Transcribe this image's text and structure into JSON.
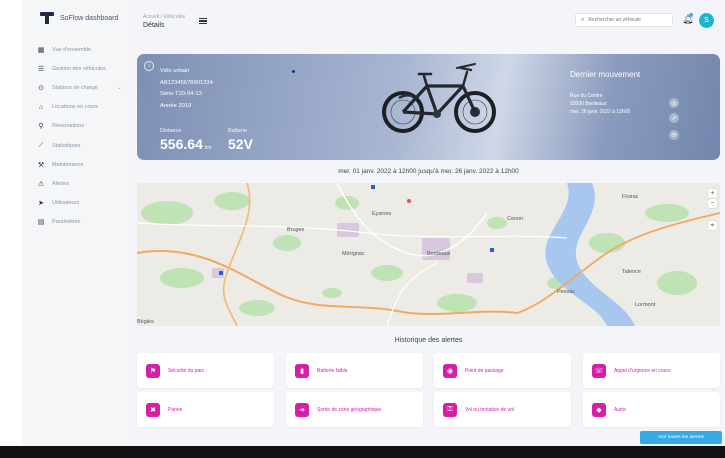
{
  "brand": {
    "name": "SoFlow dashboard"
  },
  "sidebar": {
    "items": [
      {
        "label": "Vue d'ensemble",
        "icon": "grid-icon",
        "glyph": "▦"
      },
      {
        "label": "Gestion des véhicules",
        "icon": "list-icon",
        "glyph": "☰"
      },
      {
        "label": "Stations de charge",
        "icon": "pin-icon",
        "glyph": "⊙",
        "has_caret": true
      },
      {
        "label": "Locations en cours",
        "icon": "scooter-icon",
        "glyph": "⌂"
      },
      {
        "label": "Réservations",
        "icon": "calendar-icon",
        "glyph": "⚲"
      },
      {
        "label": "Statistiques",
        "icon": "chart-icon",
        "glyph": "⟋"
      },
      {
        "label": "Maintenance",
        "icon": "wrench-icon",
        "glyph": "⚒"
      },
      {
        "label": "Alertes",
        "icon": "bell-icon",
        "glyph": "⚠"
      },
      {
        "label": "Utilisateurs",
        "icon": "user-icon",
        "glyph": "➤"
      },
      {
        "label": "Paramètres",
        "icon": "settings-icon",
        "glyph": "▤"
      }
    ]
  },
  "header": {
    "breadcrumb": "Accueil / Véhicules",
    "title": "Détails",
    "search_placeholder": "Rechercher un véhicule"
  },
  "user": {
    "initial": "S"
  },
  "hero": {
    "lines": [
      "Vélo urbain",
      "AB12345678901234",
      "Série T20-04-13",
      "Année 2019"
    ],
    "distance_label": "Distance",
    "distance_value": "556.64",
    "distance_unit": "km",
    "battery_label": "Batterie",
    "battery_value": "52V",
    "last_move_title": "Dernier mouvement",
    "last_move_lines": [
      "Rue du Centre",
      "33000 Bordeaux",
      "mer. 26 janv. 2022 à 12h00"
    ]
  },
  "map_header": "mer. 01 janv. 2022 à 12h00 jusqu'à mer. 26 janv. 2022 à 12h00",
  "map": {
    "labels": [
      "Eysines",
      "Bruges",
      "Mérignac",
      "Bordeaux",
      "Cenon",
      "Floirac",
      "Talence",
      "Pessac",
      "Bègles",
      "Lormont"
    ]
  },
  "section_title": "Historique des alertes",
  "cards": [
    {
      "label": "Sécurité du parc",
      "icon": "shield-icon",
      "glyph": "⚑"
    },
    {
      "label": "Batterie faible",
      "icon": "battery-icon",
      "glyph": "▮"
    },
    {
      "label": "Point de passage",
      "icon": "location-icon",
      "glyph": "◉"
    },
    {
      "label": "Appel d'urgence en cours",
      "icon": "phone-icon",
      "glyph": "☏"
    },
    {
      "label": "Panne",
      "icon": "warning-icon",
      "glyph": "✖"
    },
    {
      "label": "Sortie de zone géographique",
      "icon": "zone-icon",
      "glyph": "➜"
    },
    {
      "label": "Vol ou tentative de vol",
      "icon": "lock-icon",
      "glyph": "⚿"
    },
    {
      "label": "Autre",
      "icon": "dots-icon",
      "glyph": "◆"
    }
  ],
  "cta_label": "Voir toutes les alertes",
  "colors": {
    "accent": "#d41fa6",
    "primary": "#37a9e6",
    "hero": "#8a9bbf"
  }
}
